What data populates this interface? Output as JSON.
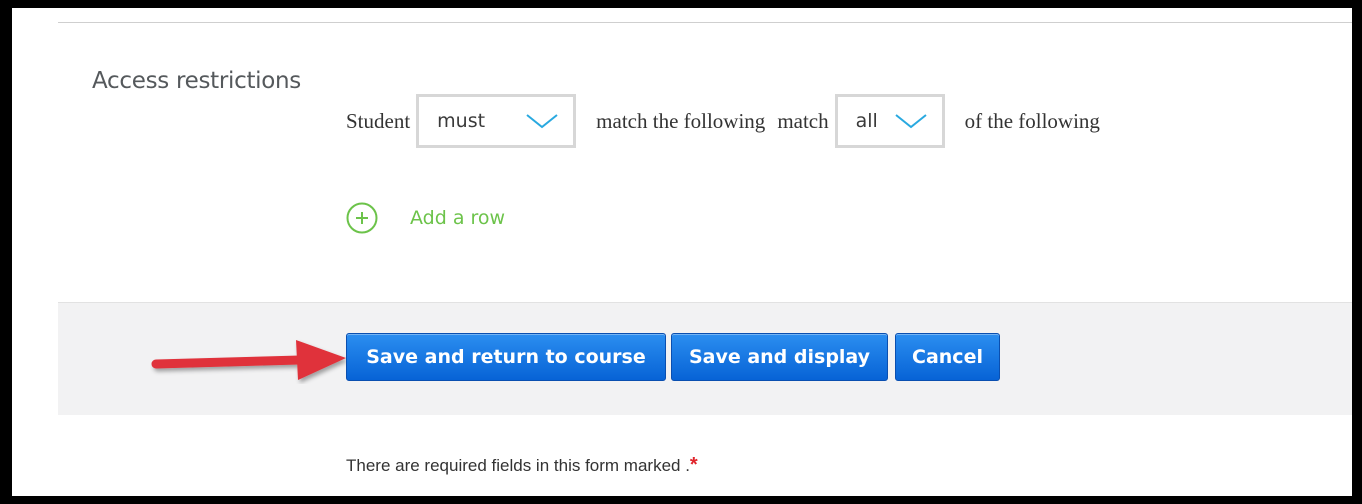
{
  "section": {
    "label": "Access restrictions"
  },
  "restriction": {
    "prefix": "Student",
    "qualifier_value": "must",
    "middle_text": "match the following",
    "match_label": "match",
    "scope_value": "all",
    "suffix": "of the following"
  },
  "add_row": {
    "label": "Add a row",
    "icon": "plus-circle-icon"
  },
  "buttons": {
    "save_return": "Save and return to course",
    "save_display": "Save and display",
    "cancel": "Cancel"
  },
  "footer": {
    "required_note": "There are required fields in this form marked .",
    "required_marker": "*"
  },
  "colors": {
    "accent_green": "#6cc34a",
    "button_blue": "#0763d6",
    "chevron_cyan": "#29a9e0",
    "annotation_red": "#e0323a",
    "required_red": "#e0242b"
  }
}
